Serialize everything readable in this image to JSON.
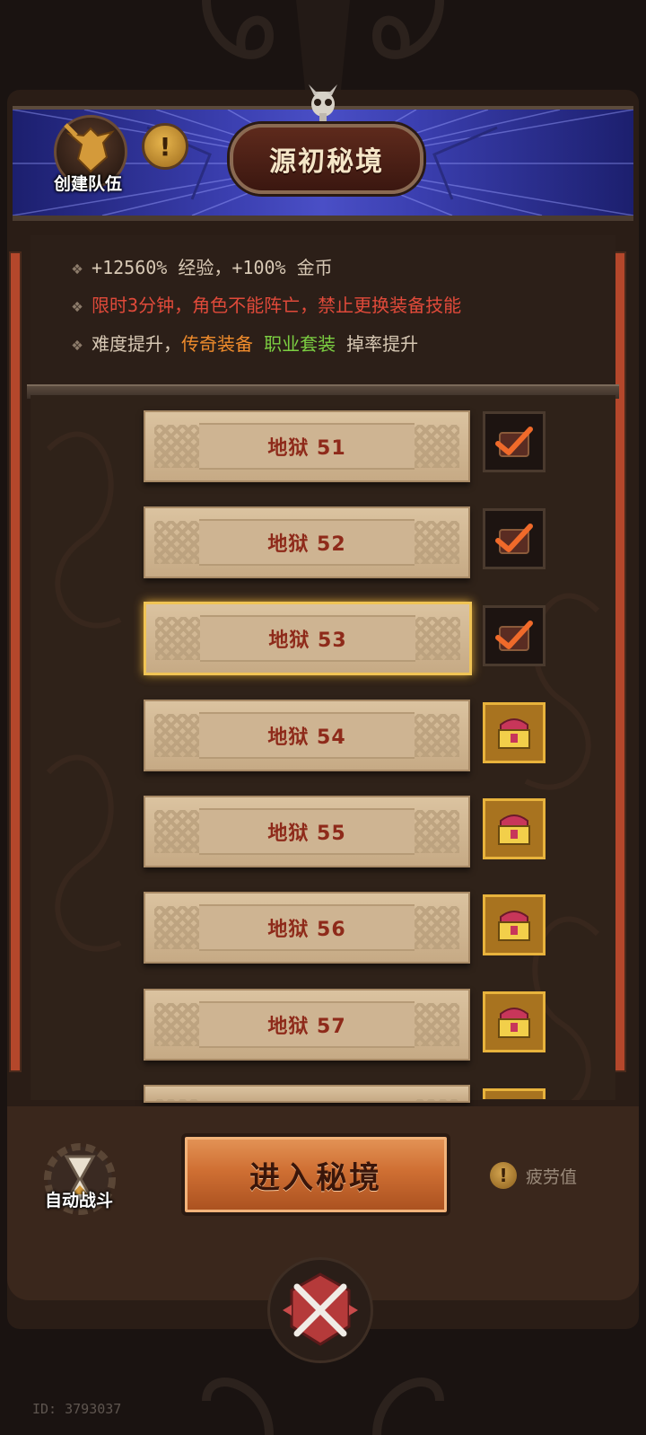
{
  "header": {
    "title": "源初秘境",
    "team_label": "创建队伍"
  },
  "info": {
    "line1": "+12560% 经验，+100% 金币",
    "line2": "限时3分钟，角色不能阵亡，禁止更换装备技能",
    "line3_prefix": "难度提升，",
    "line3_legendary": "传奇装备",
    "line3_set": "职业套装",
    "line3_suffix": "掉率提升",
    "colors": {
      "normal": "#d7c8b4",
      "warning": "#e04a3a",
      "legendary": "#f08c2c",
      "set": "#7ccf42"
    }
  },
  "levels": [
    {
      "label": "地狱 51",
      "reward": "claimed"
    },
    {
      "label": "地狱 52",
      "reward": "claimed"
    },
    {
      "label": "地狱 53",
      "reward": "claimed",
      "selected": true
    },
    {
      "label": "地狱 54",
      "reward": "available"
    },
    {
      "label": "地狱 55",
      "reward": "available"
    },
    {
      "label": "地狱 56",
      "reward": "available"
    },
    {
      "label": "地狱 57",
      "reward": "available"
    }
  ],
  "bottom": {
    "auto_battle_label": "自动战斗",
    "enter_label": "进入秘境",
    "fatigue_label": "疲劳值"
  },
  "footer": {
    "player_id": "ID: 3793037"
  },
  "icons": [
    "skull-icon",
    "team-icon",
    "info-icon",
    "chest-icon",
    "checkmark-icon",
    "hourglass-icon",
    "crossed-swords-icon"
  ]
}
